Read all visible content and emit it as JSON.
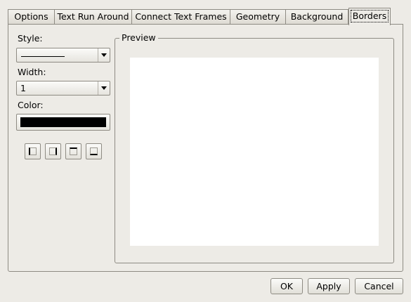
{
  "tabs": [
    {
      "label": "Options",
      "active": false
    },
    {
      "label": "Text Run Around",
      "active": false
    },
    {
      "label": "Connect Text Frames",
      "active": false
    },
    {
      "label": "Geometry",
      "active": false
    },
    {
      "label": "Background",
      "active": false
    },
    {
      "label": "Borders",
      "active": true
    }
  ],
  "borders": {
    "style_label": "Style:",
    "width_label": "Width:",
    "width_value": "1",
    "color_label": "Color:",
    "color_value": "#000000",
    "side_buttons": [
      "left-border",
      "right-border",
      "top-border",
      "bottom-border"
    ]
  },
  "preview": {
    "title": "Preview"
  },
  "buttons": {
    "ok": "OK",
    "apply": "Apply",
    "cancel": "Cancel"
  }
}
